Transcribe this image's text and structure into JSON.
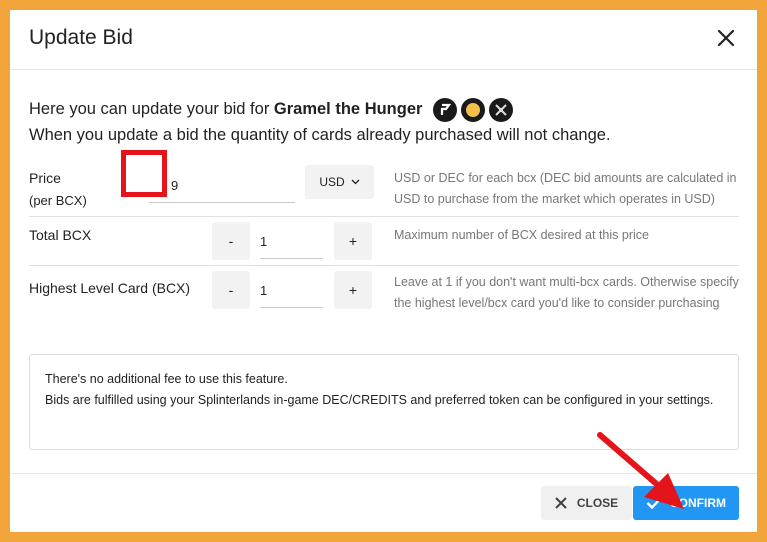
{
  "dialog": {
    "title": "Update Bid",
    "intro_prefix": "Here you can update your bid for ",
    "card_name": "Gramel the Hunger",
    "intro_line2": "When you update a bid the quantity of cards already purchased will not change."
  },
  "badges": [
    "edition-icon",
    "rarity-icon",
    "element-icon"
  ],
  "price_row": {
    "label": "Price",
    "sublabel": "(per BCX)",
    "value": "9",
    "currency": "USD",
    "help": "USD or DEC for each bcx (DEC bid amounts are calculated in USD to purchase from the market which operates in USD)"
  },
  "total_row": {
    "label": "Total BCX",
    "minus": "-",
    "value": "1",
    "plus": "+",
    "help": "Maximum number of BCX desired at this price"
  },
  "level_row": {
    "label": "Highest Level Card (BCX)",
    "minus": "-",
    "value": "1",
    "plus": "+",
    "help": "Leave at 1 if you don't want multi-bcx cards. Otherwise specify the highest level/bcx card you'd like to consider purchasing"
  },
  "info": {
    "line1": "There's no additional fee to use this feature.",
    "line2": "Bids are fulfilled using your Splinterlands in-game DEC/CREDITS and preferred token can be configured in your settings."
  },
  "footer": {
    "close_label": "CLOSE",
    "confirm_label": "CONFIRM"
  },
  "colors": {
    "background": "#f0a43a",
    "primary": "#2196f3",
    "highlight": "#e5141a"
  }
}
